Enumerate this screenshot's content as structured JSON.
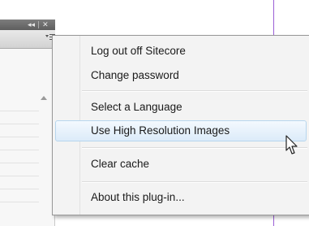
{
  "panel": {
    "controls": [
      "◂◂",
      "|",
      "✕"
    ],
    "flyout_icon": "flyout-menu-icon"
  },
  "menu": {
    "items": [
      {
        "label": "Log out off Sitecore"
      },
      {
        "label": "Change password"
      },
      {
        "label": "Select a Language"
      },
      {
        "label": "Use High Resolution Images",
        "highlighted": true
      },
      {
        "label": "Clear cache"
      },
      {
        "label": "About this plug-in..."
      }
    ]
  },
  "colors": {
    "highlight_border": "#b7d6ee",
    "highlight_fill": "#dcebf9",
    "guide_line": "#9b5fd6"
  }
}
